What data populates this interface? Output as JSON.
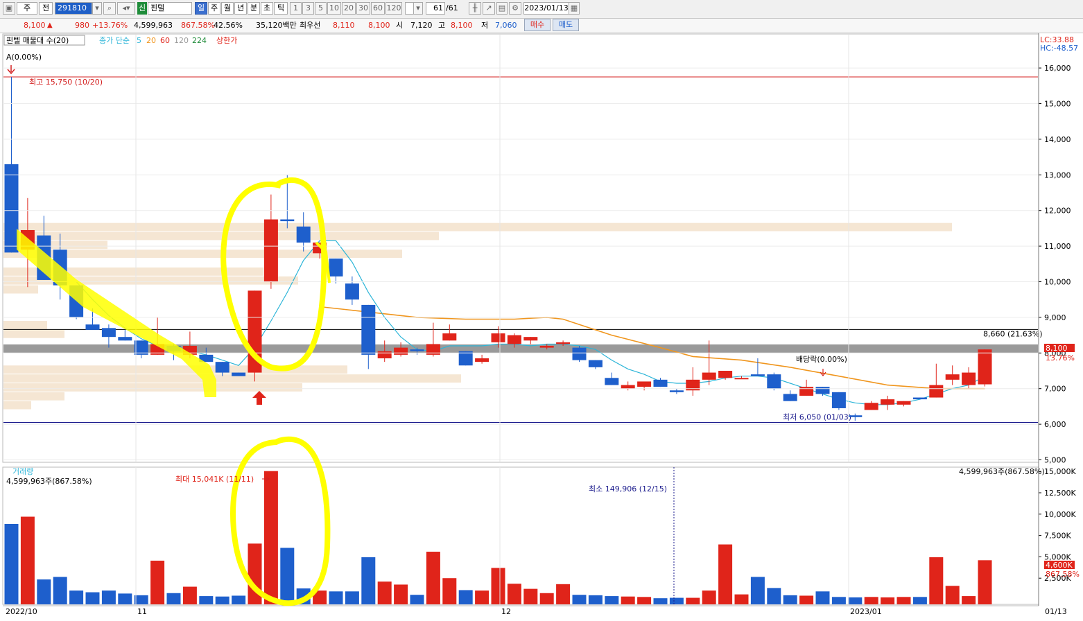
{
  "toolbar": {
    "type_label": "주",
    "market_label": "전",
    "code": "291810",
    "stock_name": "핀텔",
    "new_badge": "신",
    "periods": [
      "일",
      "주",
      "월",
      "년",
      "분",
      "초",
      "틱"
    ],
    "selected_period": "일",
    "intervals": [
      "1",
      "3",
      "5",
      "10",
      "20",
      "30",
      "60",
      "120"
    ],
    "count": "61",
    "count_total": "/61",
    "date": "2023/01/13"
  },
  "quote": {
    "price": "8,100",
    "change": "980",
    "change_pct": "+13.76%",
    "volume": "4,599,963",
    "volume_ratio": "867.58%",
    "turnover_pct": "42.56%",
    "amount": "35,120백만",
    "best_label": "최우선",
    "best_ask": "8,110",
    "best_bid": "8,100",
    "open_label": "시",
    "open": "7,120",
    "high_label": "고",
    "high": "8,100",
    "low_label": "저",
    "low": "7,060",
    "buy_label": "매수",
    "sell_label": "매도"
  },
  "colors": {
    "up": "#e0241a",
    "down": "#1e5fcc",
    "ma5": "#2cb5d8",
    "ma20": "#f0961e",
    "highlight": "#ffff00",
    "volume_profile": "#f5e6d3",
    "band": "#9a9a9a"
  },
  "chart_data": [
    {
      "type": "candlestick",
      "legend": {
        "profile": "핀텔 매물대 수(20)",
        "ma_label": "종가 단순",
        "ma_periods": [
          "5",
          "20",
          "60",
          "120",
          "224"
        ],
        "limit_up": "상한가"
      },
      "ylim": [
        5000,
        16400
      ],
      "y_ticks": [
        5000,
        6000,
        7000,
        8000,
        9000,
        10000,
        11000,
        12000,
        13000,
        14000,
        15000,
        16000
      ],
      "y_tick_labels": [
        "5,000",
        "6,000",
        "7,000",
        "8,000",
        "9,000",
        "10,000",
        "11,000",
        "12,000",
        "13,000",
        "14,000",
        "15,000",
        "16,000"
      ],
      "x_labels": [
        "2022/10",
        "11",
        "12",
        "2023/01",
        "01/13"
      ],
      "candles": [
        [
          13300,
          15750,
          10820,
          10820
        ],
        [
          10900,
          12350,
          9850,
          11450
        ],
        [
          11300,
          11850,
          10050,
          10050
        ],
        [
          10900,
          11350,
          9500,
          9900
        ],
        [
          9900,
          9900,
          8950,
          9000
        ],
        [
          8800,
          9250,
          8700,
          8650
        ],
        [
          8700,
          8800,
          8150,
          8450
        ],
        [
          8450,
          8650,
          8350,
          8350
        ],
        [
          8350,
          8350,
          7850,
          7950
        ],
        [
          7950,
          9000,
          7950,
          8250
        ],
        [
          8200,
          8250,
          7800,
          8050
        ],
        [
          7950,
          8600,
          7850,
          8200
        ],
        [
          7950,
          8150,
          7850,
          7750
        ],
        [
          7750,
          7750,
          7350,
          7450
        ],
        [
          7450,
          7450,
          7400,
          7350
        ],
        [
          7450,
          9750,
          7200,
          9750
        ],
        [
          10000,
          12450,
          9800,
          11750
        ],
        [
          11750,
          13000,
          11500,
          11700
        ],
        [
          11550,
          11950,
          10850,
          11100
        ],
        [
          10800,
          11100,
          10650,
          11100
        ],
        [
          10650,
          10650,
          9950,
          10150
        ],
        [
          9950,
          10150,
          9350,
          9500
        ],
        [
          9350,
          9350,
          7550,
          7950
        ],
        [
          7850,
          8350,
          7750,
          8050
        ],
        [
          7950,
          8300,
          7900,
          8150
        ],
        [
          8100,
          8150,
          7950,
          8050
        ],
        [
          7950,
          8850,
          7900,
          8250
        ],
        [
          8350,
          8800,
          8350,
          8550
        ],
        [
          8050,
          8050,
          7650,
          7650
        ],
        [
          7750,
          7950,
          7700,
          7850
        ],
        [
          8300,
          8750,
          8150,
          8550
        ],
        [
          8250,
          8550,
          8150,
          8500
        ],
        [
          8350,
          8450,
          8250,
          8450
        ],
        [
          8150,
          8250,
          8100,
          8200
        ],
        [
          8250,
          8350,
          8200,
          8300
        ],
        [
          8150,
          8200,
          7750,
          7800
        ],
        [
          7800,
          7800,
          7550,
          7600
        ],
        [
          7300,
          7450,
          7100,
          7100
        ],
        [
          7000,
          7200,
          6950,
          7100
        ],
        [
          7050,
          7100,
          6950,
          7200
        ],
        [
          7250,
          7300,
          7050,
          7050
        ],
        [
          6950,
          7000,
          6850,
          6900
        ],
        [
          6950,
          7600,
          6800,
          7250
        ],
        [
          7250,
          8350,
          7100,
          7450
        ],
        [
          7300,
          7300,
          7250,
          7500
        ],
        [
          7300,
          7350,
          7300,
          7300
        ],
        [
          7400,
          7850,
          7350,
          7350
        ],
        [
          7400,
          7450,
          6950,
          7000
        ],
        [
          6850,
          6950,
          6650,
          6650
        ],
        [
          6800,
          7250,
          6800,
          7050
        ],
        [
          7050,
          7050,
          6800,
          6850
        ],
        [
          6900,
          6900,
          6400,
          6450
        ],
        [
          6250,
          6300,
          6100,
          6200
        ],
        [
          6400,
          6650,
          6400,
          6600
        ],
        [
          6550,
          6800,
          6400,
          6700
        ],
        [
          6550,
          6650,
          6500,
          6650
        ],
        [
          6750,
          6750,
          6700,
          6700
        ],
        [
          6750,
          7700,
          6750,
          7100
        ],
        [
          7250,
          7650,
          7100,
          7400
        ],
        [
          7100,
          7600,
          7000,
          7450
        ],
        [
          7120,
          8100,
          7060,
          8100
        ]
      ],
      "ma5": [
        [
          4,
          10000
        ],
        [
          5,
          9500
        ],
        [
          6,
          9050
        ],
        [
          7,
          8700
        ],
        [
          8,
          8400
        ],
        [
          9,
          8200
        ],
        [
          10,
          8100
        ],
        [
          11,
          8050
        ],
        [
          12,
          7950
        ],
        [
          13,
          7800
        ],
        [
          14,
          7650
        ],
        [
          15,
          8150
        ],
        [
          16,
          8900
        ],
        [
          17,
          9700
        ],
        [
          18,
          10600
        ],
        [
          19,
          11150
        ],
        [
          20,
          11150
        ],
        [
          21,
          10550
        ],
        [
          22,
          9700
        ],
        [
          23,
          9000
        ],
        [
          24,
          8450
        ],
        [
          25,
          8100
        ],
        [
          26,
          8050
        ],
        [
          27,
          8200
        ],
        [
          28,
          8200
        ],
        [
          29,
          8200
        ],
        [
          30,
          8250
        ],
        [
          31,
          8250
        ],
        [
          32,
          8200
        ],
        [
          33,
          8250
        ],
        [
          34,
          8250
        ],
        [
          35,
          8200
        ],
        [
          36,
          8100
        ],
        [
          37,
          7800
        ],
        [
          38,
          7550
        ],
        [
          39,
          7400
        ],
        [
          40,
          7200
        ],
        [
          41,
          7150
        ],
        [
          42,
          7150
        ],
        [
          43,
          7200
        ],
        [
          44,
          7300
        ],
        [
          45,
          7350
        ],
        [
          46,
          7350
        ],
        [
          47,
          7300
        ],
        [
          48,
          7150
        ],
        [
          49,
          7000
        ],
        [
          50,
          6850
        ],
        [
          51,
          6700
        ],
        [
          52,
          6600
        ],
        [
          53,
          6550
        ],
        [
          54,
          6550
        ],
        [
          55,
          6600
        ],
        [
          56,
          6700
        ],
        [
          57,
          6850
        ],
        [
          58,
          7000
        ],
        [
          59,
          7100
        ],
        [
          60,
          7350
        ]
      ],
      "ma20": [
        [
          19,
          9300
        ],
        [
          22,
          9150
        ],
        [
          25,
          9000
        ],
        [
          28,
          8950
        ],
        [
          31,
          8950
        ],
        [
          33,
          9000
        ],
        [
          34,
          8950
        ],
        [
          35,
          8800
        ],
        [
          37,
          8500
        ],
        [
          40,
          8150
        ],
        [
          42,
          7900
        ],
        [
          45,
          7800
        ],
        [
          48,
          7600
        ],
        [
          51,
          7350
        ],
        [
          54,
          7100
        ],
        [
          57,
          7000
        ],
        [
          60,
          7000
        ]
      ],
      "hlines": [
        {
          "value": 15750,
          "color": "#d42020",
          "label": "최고 15,750 (10/20)"
        },
        {
          "value": 8660,
          "color": "#000000",
          "label": "8,660 (21.63%)"
        },
        {
          "value": 6050,
          "color": "#1a1a8c",
          "label": "최저 6,050 (01/03)"
        }
      ],
      "band": [
        8000,
        8240
      ],
      "volume_profile": [
        [
          11400,
          11650,
          1368
        ],
        [
          11150,
          11400,
          628
        ],
        [
          10900,
          11150,
          150
        ],
        [
          10650,
          10900,
          575
        ],
        [
          10150,
          10400,
          375
        ],
        [
          9900,
          10150,
          425
        ],
        [
          9650,
          9900,
          50
        ],
        [
          8650,
          8900,
          63
        ],
        [
          8400,
          8650,
          88
        ],
        [
          7400,
          7650,
          496
        ],
        [
          7150,
          7400,
          660
        ],
        [
          6900,
          7150,
          431
        ],
        [
          6650,
          6900,
          88
        ],
        [
          6400,
          6650,
          40
        ]
      ],
      "annotations": {
        "top_marker": "A(0.00%)",
        "ex_dividend": "배당락(0.00%)",
        "rc_top": "LC:33.88",
        "rc_bottom": "HC:-48.57",
        "last_price": "8,100",
        "last_pct": "13.76%"
      }
    },
    {
      "type": "bar",
      "title": "거래량",
      "subtitle": "4,599,963주(867.58%)",
      "right_label": "4,599,963주(867.58%)",
      "max_label": "최대 15,041K (11/11)",
      "min_label": "최소 149,906 (12/15)",
      "ylim": [
        0,
        16200
      ],
      "y_ticks": [
        2500,
        5000,
        7500,
        10000,
        12500,
        15000
      ],
      "y_tick_labels": [
        "2,500K",
        "5,000K",
        "7,500K",
        "10,000K",
        "12,500K",
        "15,000K"
      ],
      "last_value": "4,600K",
      "last_pct": "867.58%",
      "values": [
        8850,
        9700,
        2350,
        2650,
        1050,
        850,
        1050,
        700,
        500,
        4550,
        750,
        1500,
        400,
        350,
        450,
        6550,
        15041,
        6050,
        1300,
        1050,
        950,
        950,
        4950,
        2100,
        1750,
        550,
        5600,
        2500,
        1100,
        1050,
        3700,
        1850,
        1250,
        750,
        1800,
        550,
        500,
        400,
        350,
        300,
        150,
        200,
        200,
        1050,
        6450,
        600,
        2650,
        1350,
        500,
        450,
        950,
        300,
        250,
        300,
        250,
        300,
        300,
        4950,
        1600,
        400,
        4600
      ]
    }
  ]
}
